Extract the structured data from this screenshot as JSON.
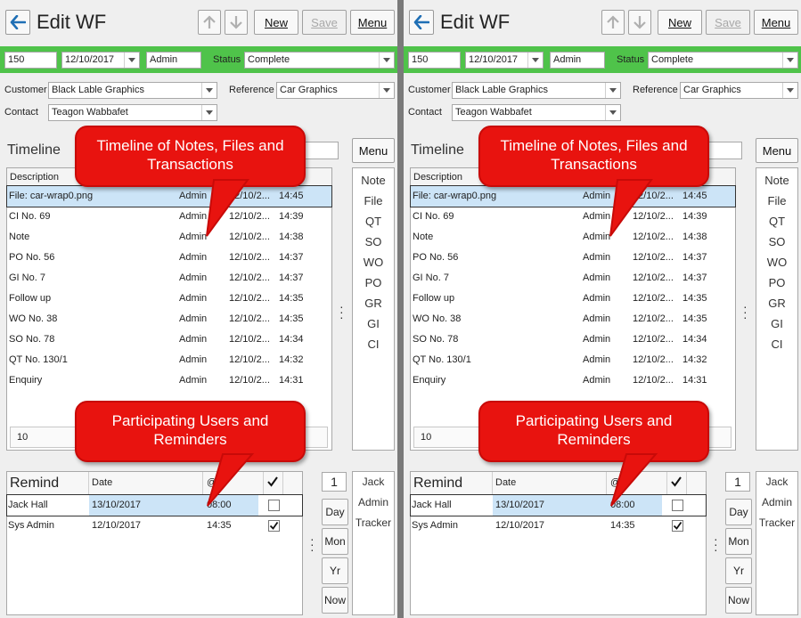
{
  "header": {
    "title": "Edit WF",
    "new_label": "New",
    "save_label": "Save",
    "menu_label": "Menu"
  },
  "bar": {
    "number": "150",
    "date": "12/10/2017",
    "user": "Admin",
    "status_label": "Status",
    "status_value": "Complete"
  },
  "form": {
    "customer_label": "Customer",
    "customer_value": "Black Lable Graphics",
    "reference_label": "Reference",
    "reference_value": "Car Graphics",
    "contact_label": "Contact",
    "contact_value": "Teagon Wabbafet"
  },
  "timeline": {
    "title": "Timeline",
    "menu_label": "Menu",
    "col_description": "Description",
    "footer_value": "10",
    "rows": [
      {
        "desc": "File: car-wrap0.png",
        "user": "Admin",
        "date": "12/10/2...",
        "time": "14:45"
      },
      {
        "desc": "CI No. 69",
        "user": "Admin",
        "date": "12/10/2...",
        "time": "14:39"
      },
      {
        "desc": "Note",
        "user": "Admin",
        "date": "12/10/2...",
        "time": "14:38"
      },
      {
        "desc": "PO No. 56",
        "user": "Admin",
        "date": "12/10/2...",
        "time": "14:37"
      },
      {
        "desc": "GI No. 7",
        "user": "Admin",
        "date": "12/10/2...",
        "time": "14:37"
      },
      {
        "desc": "Follow up",
        "user": "Admin",
        "date": "12/10/2...",
        "time": "14:35"
      },
      {
        "desc": "WO No. 38",
        "user": "Admin",
        "date": "12/10/2...",
        "time": "14:35"
      },
      {
        "desc": "SO No. 78",
        "user": "Admin",
        "date": "12/10/2...",
        "time": "14:34"
      },
      {
        "desc": "QT No. 130/1",
        "user": "Admin",
        "date": "12/10/2...",
        "time": "14:32"
      },
      {
        "desc": "Enquiry",
        "user": "Admin",
        "date": "12/10/2...",
        "time": "14:31"
      }
    ],
    "side_buttons": [
      "Note",
      "File",
      "QT",
      "SO",
      "WO",
      "PO",
      "GR",
      "GI",
      "CI"
    ]
  },
  "remind": {
    "title": "Remind",
    "col_date": "Date",
    "col_at": "@",
    "counter": "1",
    "rows": [
      {
        "name": "Jack Hall",
        "date": "13/10/2017",
        "time": "08:00",
        "checked": false
      },
      {
        "name": "Sys Admin",
        "date": "12/10/2017",
        "time": "14:35",
        "checked": true
      }
    ],
    "buttons": [
      "Day",
      "Mon",
      "Yr",
      "Now"
    ],
    "users": [
      "Jack",
      "Admin",
      "Tracker"
    ]
  },
  "callouts": {
    "timeline": "Timeline of Notes, Files and Transactions",
    "users": "Participating Users and Reminders"
  },
  "colors": {
    "green_bar": "#4fc34a",
    "callout": "#e8130f",
    "selection": "#cce4f7"
  }
}
